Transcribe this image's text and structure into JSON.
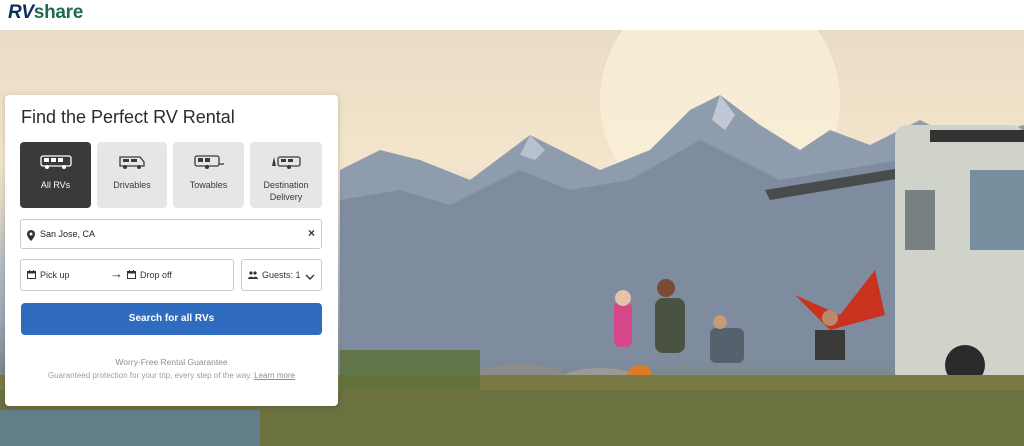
{
  "brand": {
    "logo_rv": "RV",
    "logo_share": "share"
  },
  "search_card": {
    "title": "Find the Perfect RV Rental",
    "rv_types": [
      {
        "label": "All RVs",
        "icon": "motorhome-icon",
        "active": true
      },
      {
        "label": "Drivables",
        "icon": "campervan-icon",
        "active": false
      },
      {
        "label": "Towables",
        "icon": "travel-trailer-icon",
        "active": false
      },
      {
        "label_line1": "Destination",
        "label_line2": "Delivery",
        "icon": "delivered-trailer-icon",
        "active": false
      }
    ],
    "location": {
      "value": "San Jose, CA",
      "clear": "×"
    },
    "dates": {
      "pickup": "Pick up",
      "arrow": "→",
      "dropoff": "Drop off"
    },
    "guests": {
      "label": "Guests: 1"
    },
    "search_button": "Search for all RVs",
    "guarantee_title": "Worry-Free Rental Guarantee",
    "guarantee_text": "Guaranteed protection for your trip, every step of the way.",
    "learn_more": "Learn more"
  },
  "colors": {
    "brand_green": "#1f6b4f",
    "brand_navy": "#0d2e5c",
    "primary_button": "#2f6cbf",
    "active_tile": "#3a3a3a"
  }
}
